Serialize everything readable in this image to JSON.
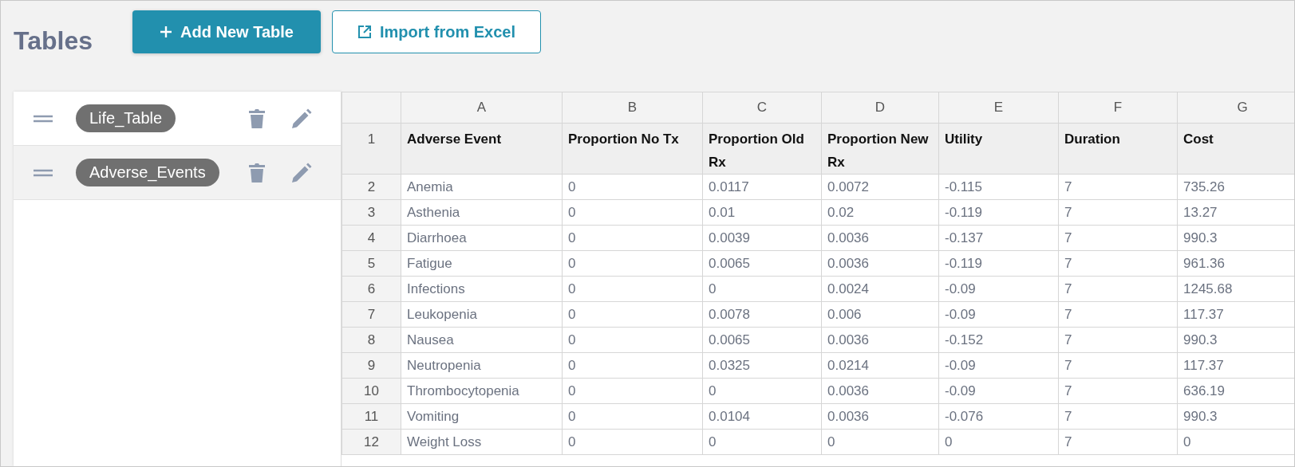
{
  "page_title": "Tables",
  "buttons": [
    {
      "label": "Add New Table",
      "kind": "primary"
    },
    {
      "label": "Import from Excel",
      "kind": "outline"
    }
  ],
  "tables": [
    {
      "name": "Life_Table",
      "selected": false
    },
    {
      "name": "Adverse_Events",
      "selected": true
    }
  ],
  "sheet": {
    "columns": [
      "A",
      "B",
      "C",
      "D",
      "E",
      "F",
      "G"
    ],
    "rows": [
      {
        "number": "1",
        "kind": "header",
        "cells": [
          "Adverse Event",
          "Proportion No Tx",
          "Proportion Old Rx",
          "Proportion New Rx",
          "Utility",
          "Duration",
          "Cost"
        ]
      },
      {
        "number": "2",
        "kind": "data",
        "cells": [
          "Anemia",
          "0",
          "0.0117",
          "0.0072",
          "-0.115",
          "7",
          "735.26"
        ]
      },
      {
        "number": "3",
        "kind": "data",
        "cells": [
          "Asthenia",
          "0",
          "0.01",
          "0.02",
          "-0.119",
          "7",
          "13.27"
        ]
      },
      {
        "number": "4",
        "kind": "data",
        "cells": [
          "Diarrhoea",
          "0",
          "0.0039",
          "0.0036",
          "-0.137",
          "7",
          "990.3"
        ]
      },
      {
        "number": "5",
        "kind": "data",
        "cells": [
          "Fatigue",
          "0",
          "0.0065",
          "0.0036",
          "-0.119",
          "7",
          "961.36"
        ]
      },
      {
        "number": "6",
        "kind": "data",
        "cells": [
          "Infections",
          "0",
          "0",
          "0.0024",
          "-0.09",
          "7",
          "1245.68"
        ]
      },
      {
        "number": "7",
        "kind": "data",
        "cells": [
          "Leukopenia",
          "0",
          "0.0078",
          "0.006",
          "-0.09",
          "7",
          "117.37"
        ]
      },
      {
        "number": "8",
        "kind": "data",
        "cells": [
          "Nausea",
          "0",
          "0.0065",
          "0.0036",
          "-0.152",
          "7",
          "990.3"
        ]
      },
      {
        "number": "9",
        "kind": "data",
        "cells": [
          "Neutropenia",
          "0",
          "0.0325",
          "0.0214",
          "-0.09",
          "7",
          "117.37"
        ]
      },
      {
        "number": "10",
        "kind": "data",
        "cells": [
          "Thrombocytopenia",
          "0",
          "0",
          "0.0036",
          "-0.09",
          "7",
          "636.19"
        ]
      },
      {
        "number": "11",
        "kind": "data",
        "cells": [
          "Vomiting",
          "0",
          "0.0104",
          "0.0036",
          "-0.076",
          "7",
          "990.3"
        ]
      },
      {
        "number": "12",
        "kind": "data",
        "cells": [
          "Weight Loss",
          "0",
          "0",
          "0",
          "0",
          "7",
          "0"
        ]
      }
    ]
  }
}
